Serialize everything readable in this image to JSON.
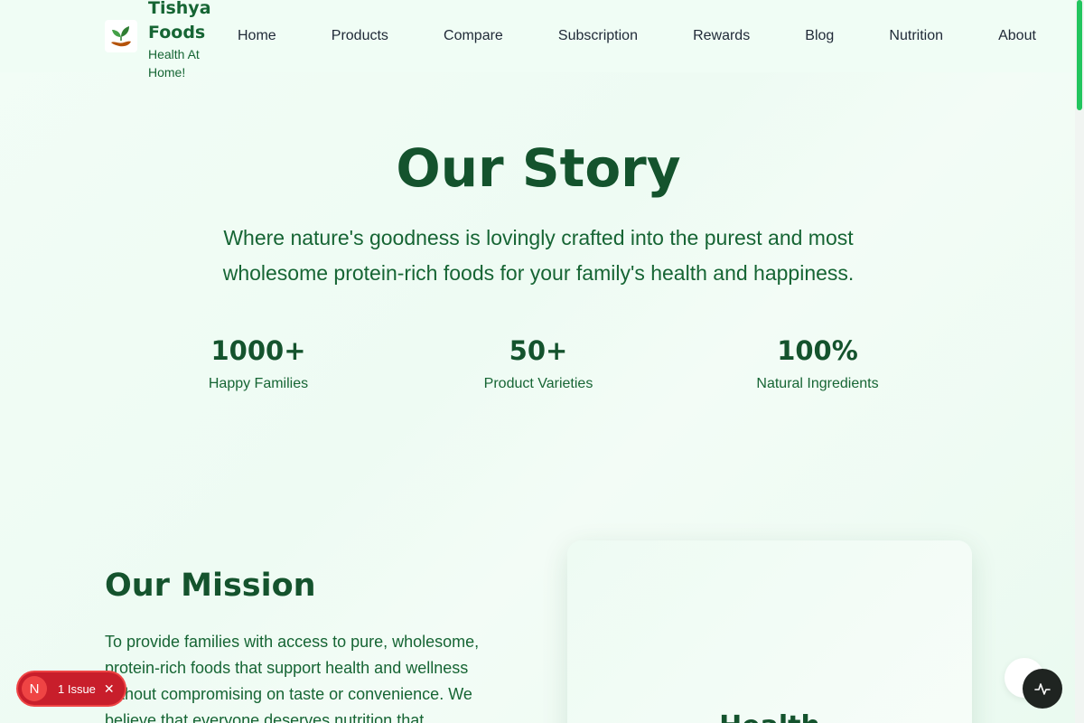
{
  "brand": {
    "name": "Tishya Foods",
    "tagline": "Health At Home!"
  },
  "nav": {
    "items": [
      "Home",
      "Products",
      "Compare",
      "Subscription",
      "Rewards",
      "Blog",
      "Nutrition",
      "About"
    ]
  },
  "hero": {
    "title": "Our Story",
    "subtitle": "Where nature's goodness is lovingly crafted into the purest and most wholesome protein-rich foods for your family's health and happiness."
  },
  "stats": [
    {
      "value": "1000+",
      "label": "Happy Families"
    },
    {
      "value": "50+",
      "label": "Product Varieties"
    },
    {
      "value": "100%",
      "label": "Natural Ingredients"
    }
  ],
  "mission": {
    "title": "Our Mission",
    "text": "To provide families with access to pure, wholesome, protein-rich foods that support health and wellness without compromising on taste or convenience. We believe that everyone deserves nutrition that"
  },
  "card": {
    "heading": "Health"
  },
  "dev_overlay": {
    "badge_letter": "N",
    "issues_label": "1 Issue",
    "close_glyph": "✕"
  },
  "colors": {
    "primary": "#14532d",
    "accent": "#22c55e",
    "issue_red": "#c81e2b"
  },
  "icons": {
    "logo": "leaf-hand-icon",
    "activity": "activity-pulse-icon"
  }
}
